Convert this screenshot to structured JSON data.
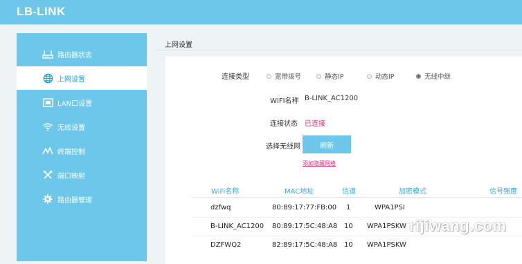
{
  "brand": {
    "logo_text_pre": "LB",
    "logo_dash": "-",
    "logo_text_post": "LINK"
  },
  "sidebar": {
    "items": [
      {
        "label": "路由器状态",
        "icon": "router-status-icon",
        "active": false
      },
      {
        "label": "上网设置",
        "icon": "globe-icon",
        "active": true
      },
      {
        "label": "LAN口设置",
        "icon": "lan-port-icon",
        "active": false
      },
      {
        "label": "无线设置",
        "icon": "wifi-icon",
        "active": false
      },
      {
        "label": "终端控制",
        "icon": "terminal-control-icon",
        "active": false
      },
      {
        "label": "端口映射",
        "icon": "port-mapping-icon",
        "active": false
      },
      {
        "label": "路由器管理",
        "icon": "gear-icon",
        "active": false
      }
    ]
  },
  "main": {
    "title": "上网设置",
    "connection_type": {
      "label": "连接类型",
      "options": [
        {
          "label": "宽带拨号",
          "selected": false
        },
        {
          "label": "静态IP",
          "selected": false
        },
        {
          "label": "动态IP",
          "selected": false
        },
        {
          "label": "无线中继",
          "selected": true
        }
      ]
    },
    "wifi_name": {
      "label": "WIFI名称",
      "value": "B-LINK_AC1200"
    },
    "connection_status": {
      "label": "连接状态",
      "value": "已连接"
    },
    "select_wireless": {
      "label": "选择无线网",
      "button": "刷新",
      "link": "添加隐藏网络"
    },
    "table": {
      "headers": [
        "WiFi名称",
        "MAC地址",
        "信道",
        "加密模式",
        "信号强度"
      ],
      "rows": [
        {
          "name": "dzfwq",
          "mac": "80:89:17:77:FB:00",
          "channel": "1",
          "encryption": "WPA1PSI"
        },
        {
          "name": "B-LINK_AC1200",
          "mac": "80:89:17:5C:48:A8",
          "channel": "10",
          "encryption": "WPA1PSKW"
        },
        {
          "name": "DZFWQ2",
          "mac": "82:89:17:5C:48:A8",
          "channel": "10",
          "encryption": "WPA1PSKW"
        }
      ]
    }
  },
  "watermark": "rijiwang.com",
  "colors": {
    "accent": "#6cc7ea",
    "link": "#e0297a",
    "header": "#3aa8d8"
  }
}
